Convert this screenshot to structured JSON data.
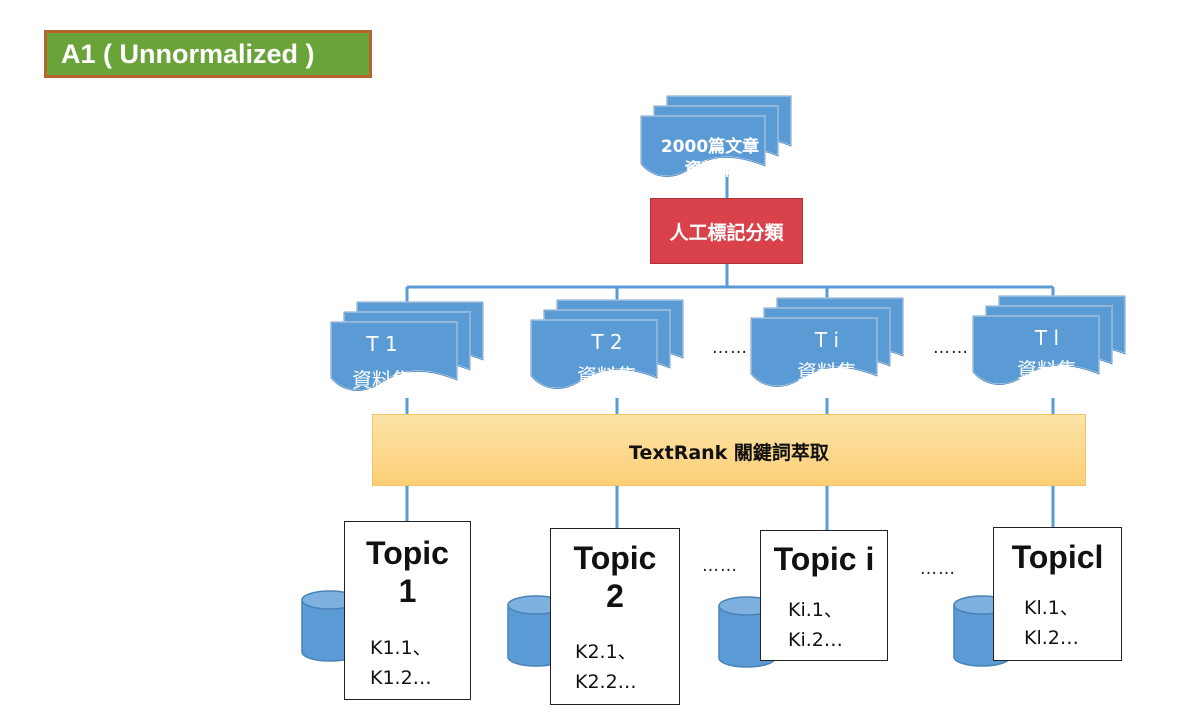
{
  "title_badge": "A1 ( Unnormalized )",
  "source_dataset": {
    "line1": "2000篇文章",
    "line2": "資料集"
  },
  "classification_step": "人工標記分類",
  "topic_datasets": [
    {
      "label": "T 1",
      "sub": "資料集"
    },
    {
      "label": "T 2",
      "sub": "資料集"
    },
    {
      "label": "T i",
      "sub": "資料集"
    },
    {
      "label": "T l",
      "sub": "資料集"
    }
  ],
  "dataset_ellipses": [
    "……",
    "……"
  ],
  "extraction_step": "TextRank 關鍵詞萃取",
  "topics": [
    {
      "title_line1": "Topic",
      "title_line2": "1",
      "kw1": "K1.1、",
      "kw2": "K1.2…"
    },
    {
      "title_line1": "Topic",
      "title_line2": "2",
      "kw1": "K2.1、",
      "kw2": "K2.2…"
    },
    {
      "title_line1": "Topic i",
      "title_line2": "",
      "kw1": "Ki.1、",
      "kw2": "Ki.2…"
    },
    {
      "title_line1": "Topicl",
      "title_line2": "",
      "kw1": "Kl.1、",
      "kw2": "Kl.2…"
    }
  ],
  "topic_ellipses": [
    "……",
    "……"
  ],
  "colors": {
    "doc_fill": "#5b9bd5",
    "doc_stroke": "#4a82b8",
    "connector": "#5b9bd5",
    "classification_fill": "#d9424a",
    "extraction_fill": "#fcd88b",
    "badge_fill": "#6aa339",
    "badge_border": "#b5652a"
  }
}
